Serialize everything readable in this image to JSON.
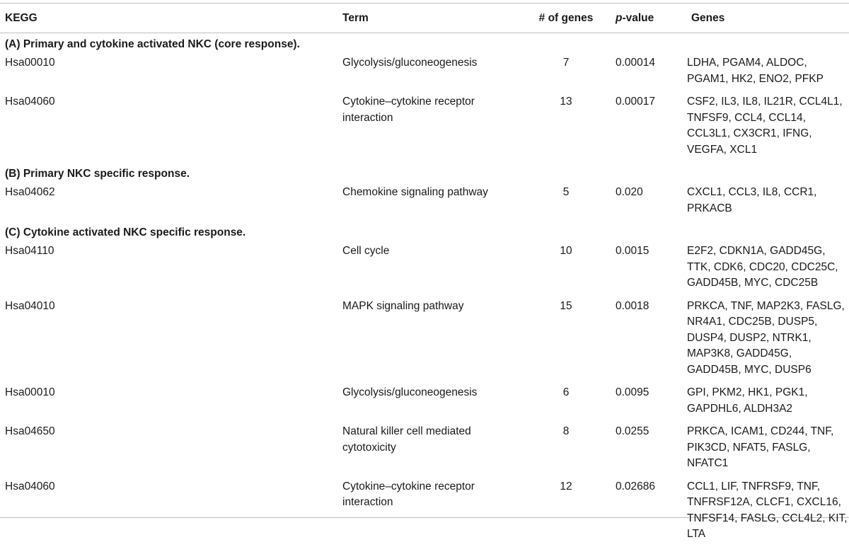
{
  "header": {
    "kegg": "KEGG",
    "term": "Term",
    "genes_count": "# of genes",
    "pvalue_italic": "p",
    "pvalue_rest": "-value",
    "genes": "Genes"
  },
  "sections": [
    {
      "title": "(A) Primary and cytokine activated NKC (core response).",
      "rows": [
        {
          "kegg": "Hsa00010",
          "term": "Glycolysis/gluconeogenesis",
          "n": "7",
          "p": "0.00014",
          "genes": "LDHA, PGAM4, ALDOC, PGAM1, HK2, ENO2, PFKP"
        },
        {
          "kegg": "Hsa04060",
          "term": "Cytokine–cytokine receptor interaction",
          "n": "13",
          "p": "0.00017",
          "genes": "CSF2, IL3, IL8, IL21R, CCL4L1, TNFSF9, CCL4, CCL14, CCL3L1, CX3CR1, IFNG, VEGFA, XCL1"
        }
      ]
    },
    {
      "title": "(B) Primary NKC specific response.",
      "rows": [
        {
          "kegg": "Hsa04062",
          "term": "Chemokine signaling pathway",
          "n": "5",
          "p": "0.020",
          "genes": "CXCL1, CCL3, IL8, CCR1, PRKACB"
        }
      ]
    },
    {
      "title": "(C) Cytokine activated NKC specific response.",
      "rows": [
        {
          "kegg": "Hsa04110",
          "term": "Cell cycle",
          "n": "10",
          "p": "0.0015",
          "genes": "E2F2, CDKN1A, GADD45G, TTK, CDK6, CDC20, CDC25C, GADD45B, MYC, CDC25B"
        },
        {
          "kegg": "Hsa04010",
          "term": "MAPK signaling pathway",
          "n": "15",
          "p": "0.0018",
          "genes": "PRKCA, TNF, MAP2K3, FASLG, NR4A1, CDC25B, DUSP5, DUSP4, DUSP2, NTRK1, MAP3K8, GADD45G, GADD45B, MYC, DUSP6"
        },
        {
          "kegg": "Hsa00010",
          "term": "Glycolysis/gluconeogenesis",
          "n": "6",
          "p": "0.0095",
          "genes": "GPI, PKM2, HK1, PGK1, GAPDHL6, ALDH3A2"
        },
        {
          "kegg": "Hsa04650",
          "term": "Natural killer cell mediated cytotoxicity",
          "n": "8",
          "p": "0.0255",
          "genes": "PRKCA, ICAM1, CD244, TNF, PIK3CD, NFAT5, FASLG, NFATC1"
        },
        {
          "kegg": "Hsa04060",
          "term": "Cytokine–cytokine receptor interaction",
          "n": "12",
          "p": "0.02686",
          "genes": "CCL1, LIF, TNFRSF9, TNF, TNFRSF12A, CLCF1, CXCL16, TNFSF14, FASLG, CCL4L2, KIT, LTA"
        }
      ]
    }
  ]
}
